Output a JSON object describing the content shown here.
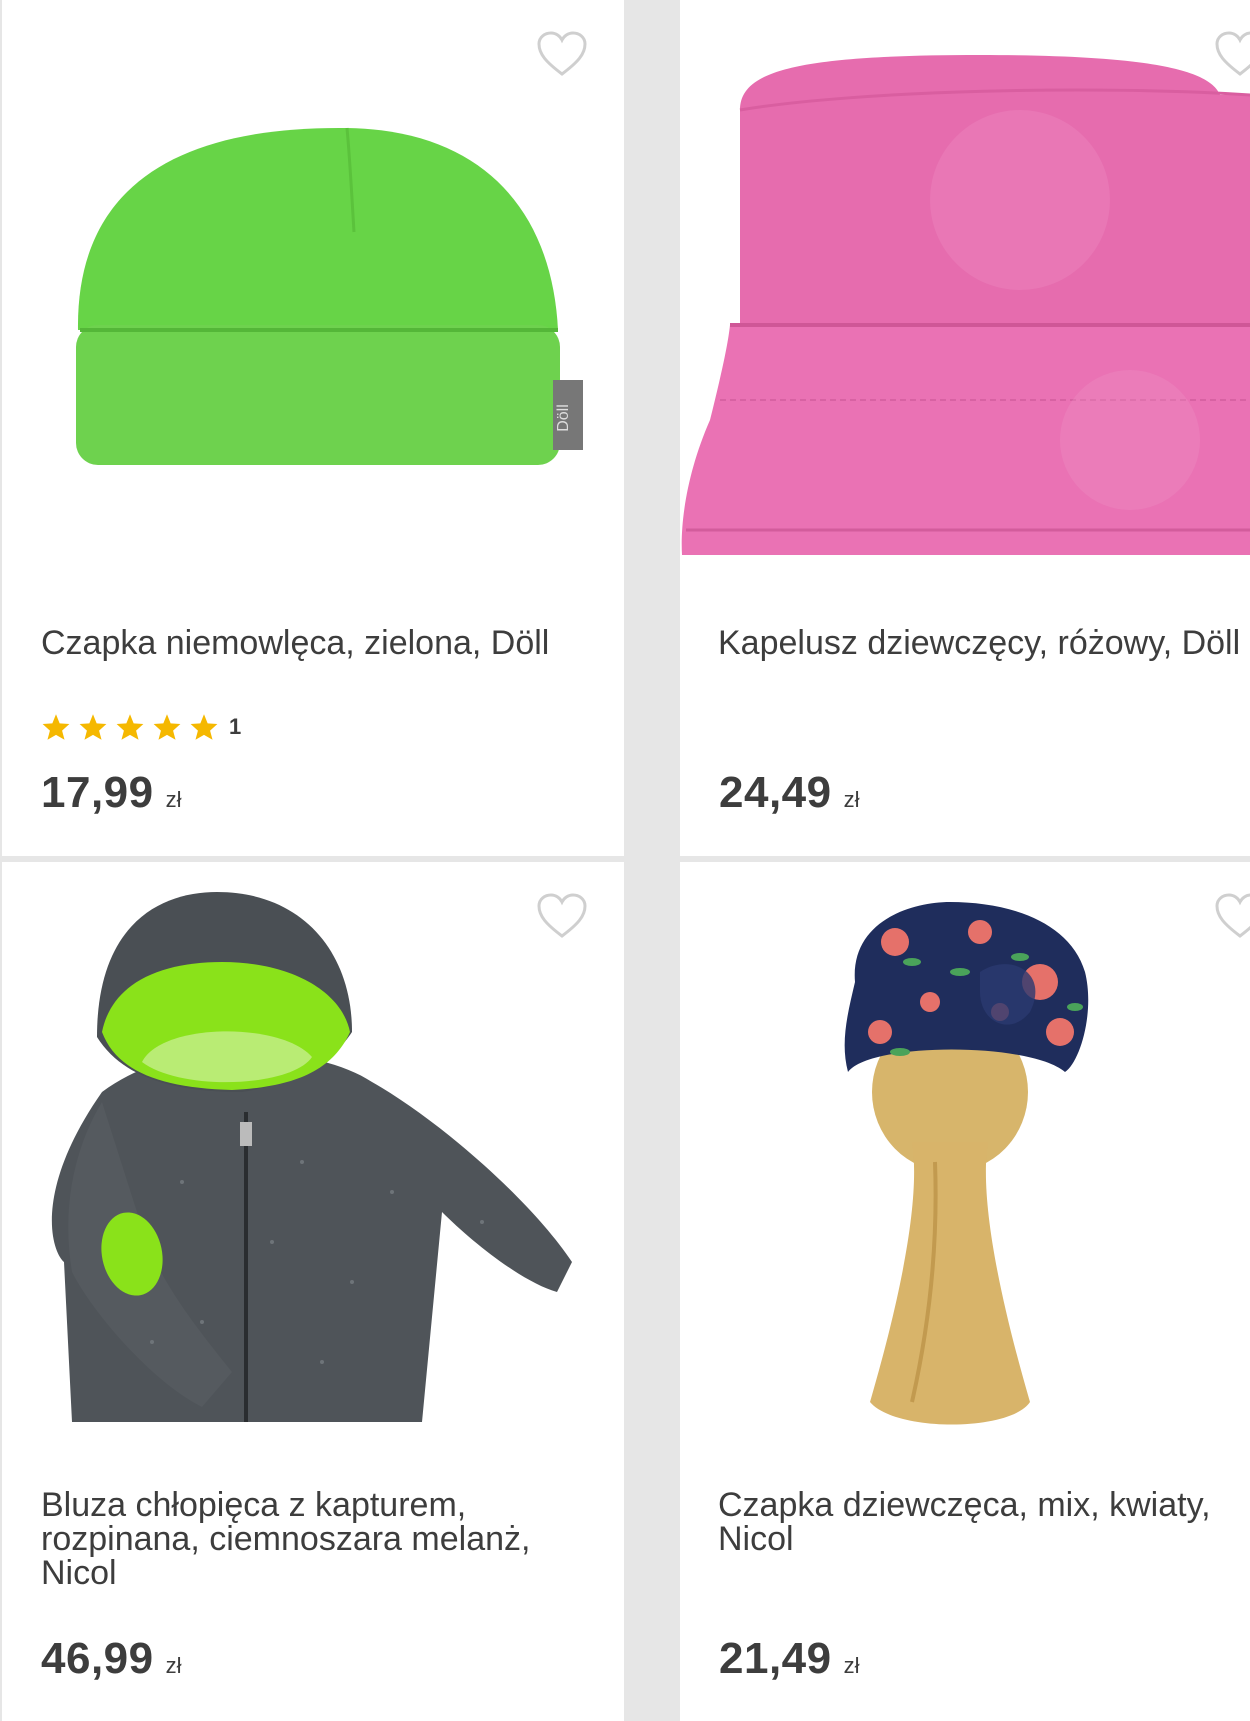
{
  "products": [
    {
      "title": "Czapka niemowlęca, zielona, Döll",
      "rating": {
        "stars": 5,
        "count": "1"
      },
      "price": "17,99",
      "currency": "zł",
      "image": "green-baby-beanie",
      "tag_text": "Döll"
    },
    {
      "title": "Kapelusz dziewczęcy, różowy, Döll",
      "price": "24,49",
      "currency": "zł",
      "image": "pink-bucket-hat"
    },
    {
      "title": "Bluza chłopięca z kapturem,\nrozpinana, ciemnoszara melanż,\nNicol",
      "price": "46,99",
      "currency": "zł",
      "image": "dark-grey-zip-hoodie"
    },
    {
      "title": "Czapka dziewczęca, mix, kwiaty,\nNicol",
      "price": "21,49",
      "currency": "zł",
      "image": "floral-turban-cap"
    }
  ],
  "colors": {
    "star": "#f5b800",
    "heart_outline": "#cfcfcf",
    "text": "#3d3d3d"
  }
}
